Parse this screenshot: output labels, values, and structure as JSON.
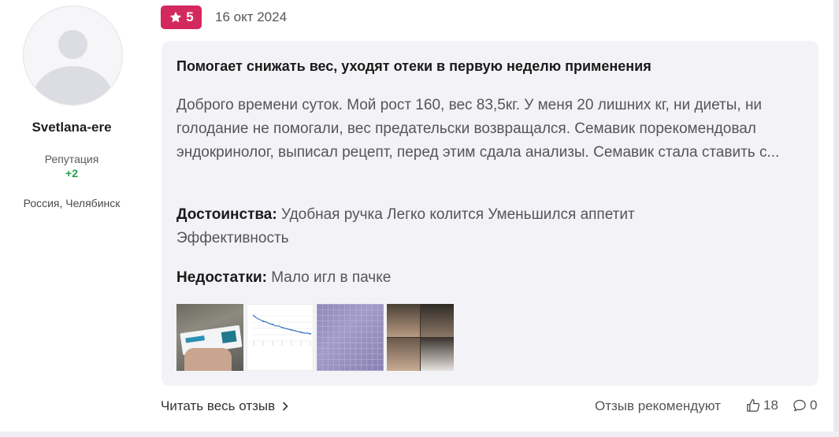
{
  "author": {
    "name": "Svetlana-ere",
    "reputation_label": "Репутация",
    "reputation_value": "+2",
    "location": "Россия, Челябинск"
  },
  "review": {
    "rating": "5",
    "date": "16 окт 2024",
    "title": "Помогает снижать вес, уходят отеки в первую неделю применения",
    "text": "Доброго времени суток. Мой рост 160, вес 83,5кг. У меня 20 лишних кг, ни диеты, ни голодание не помогали, вес предательски возвращался. Семавик порекомендовал эндокринолог, выписал рецепт, перед этим сдала анализы. Семавик стала ставить с...",
    "pros_label": "Достоинства:",
    "pros": "Удобная ручка Легко колится Уменьшился аппетит Эффективность",
    "cons_label": "Недостатки:",
    "cons": "Мало игл в пачке",
    "photos": [
      {
        "name": "photo-1"
      },
      {
        "name": "photo-2"
      },
      {
        "name": "photo-3"
      },
      {
        "name": "photo-4"
      }
    ]
  },
  "footer": {
    "read_more": "Читать весь отзыв",
    "recommend_label": "Отзыв рекомендуют",
    "likes": "18",
    "comments": "0"
  },
  "colors": {
    "badge": "#d3295e",
    "reputation": "#23a34a",
    "card_bg": "#f3f3f7"
  },
  "icons": {
    "rating": "star-icon",
    "read_more": "chevron-right-icon",
    "likes": "thumbs-up-icon",
    "comments": "comment-bubble-icon"
  }
}
